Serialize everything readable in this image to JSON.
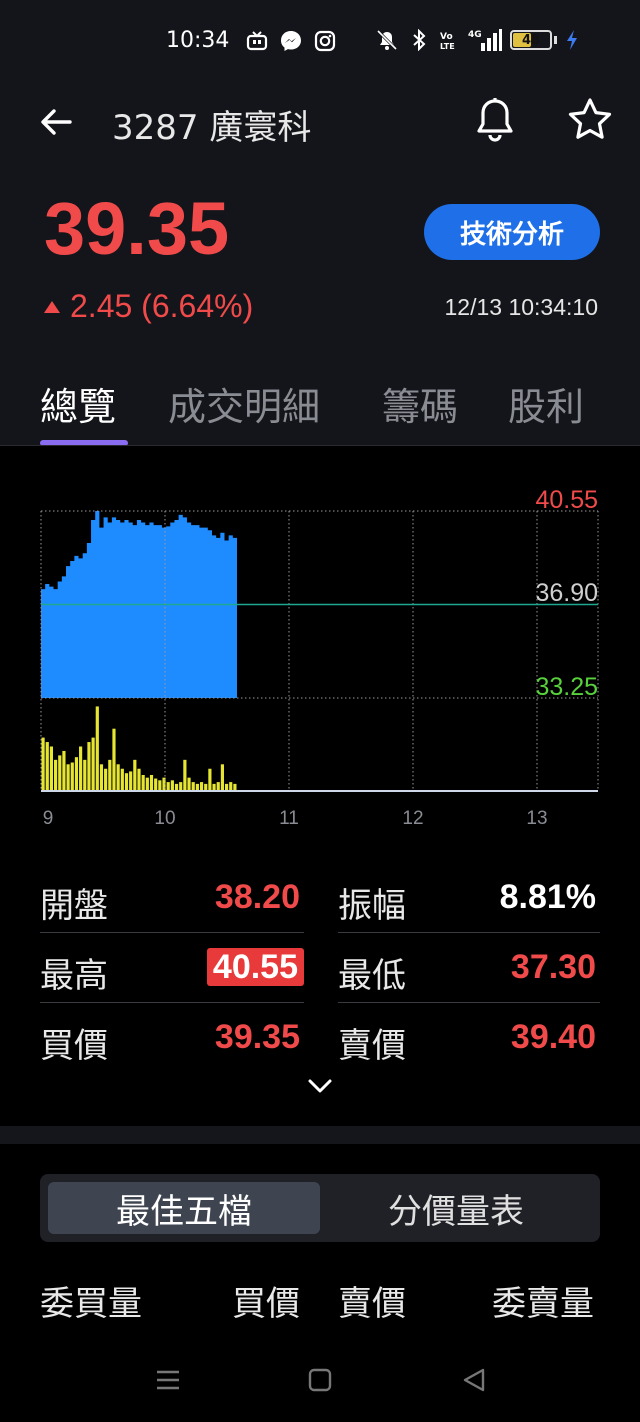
{
  "status_bar": {
    "time": "10:34",
    "battery_level": "48",
    "icons": [
      "tv-app-icon",
      "messenger-icon",
      "instagram-icon",
      "mute-icon",
      "bluetooth-icon",
      "volte-icon",
      "signal-4g-icon",
      "battery-icon",
      "charging-icon"
    ]
  },
  "header": {
    "stock_title": "3287 廣寰科",
    "icons": [
      "back-arrow-icon",
      "bell-icon",
      "star-icon"
    ]
  },
  "quote": {
    "price": "39.35",
    "change": "2.45 (6.64%)",
    "timestamp": "12/13 10:34:10",
    "technical_button": "技術分析"
  },
  "tabs": [
    "總覽",
    "成交明細",
    "籌碼",
    "股利"
  ],
  "chart_data": {
    "type": "area",
    "y_labels": [
      "40.55",
      "36.90",
      "33.25"
    ],
    "x_labels": [
      "9",
      "10",
      "11",
      "12",
      "13"
    ],
    "ylim": [
      33.25,
      40.55
    ],
    "reference_price": 36.9,
    "price_series": [
      37.5,
      37.7,
      37.6,
      37.5,
      37.8,
      38.0,
      38.4,
      38.6,
      38.8,
      38.7,
      38.9,
      39.3,
      40.2,
      40.55,
      39.9,
      40.3,
      40.1,
      40.3,
      40.2,
      40.1,
      40.2,
      40.1,
      40.0,
      40.2,
      40.1,
      40.0,
      40.1,
      40.0,
      40.0,
      39.9,
      39.95,
      40.1,
      40.2,
      40.4,
      40.3,
      40.1,
      40.0,
      40.0,
      39.9,
      39.9,
      39.8,
      39.6,
      39.5,
      39.7,
      39.4,
      39.6,
      39.5
    ],
    "volume_series": [
      0.6,
      0.55,
      0.5,
      0.35,
      0.4,
      0.45,
      0.3,
      0.32,
      0.38,
      0.5,
      0.35,
      0.55,
      0.6,
      0.95,
      0.3,
      0.25,
      0.35,
      0.7,
      0.3,
      0.25,
      0.2,
      0.22,
      0.35,
      0.25,
      0.18,
      0.15,
      0.18,
      0.14,
      0.12,
      0.15,
      0.1,
      0.12,
      0.08,
      0.1,
      0.35,
      0.15,
      0.1,
      0.08,
      0.1,
      0.08,
      0.25,
      0.08,
      0.1,
      0.3,
      0.08,
      0.1,
      0.08
    ],
    "colors": {
      "area": "#1e8cff",
      "volume": "#e6e632",
      "ref_line": "#1fa890",
      "top_label": "#f04a4a",
      "mid_label": "#cfcfcf",
      "bottom_label": "#58d13c"
    }
  },
  "stats": {
    "rows": [
      {
        "label_left": "開盤",
        "value_left": "38.20",
        "label_right": "振幅",
        "value_right": "8.81%"
      },
      {
        "label_left": "最高",
        "value_left": "40.55",
        "label_right": "最低",
        "value_right": "37.30"
      },
      {
        "label_left": "買價",
        "value_left": "39.35",
        "label_right": "賣價",
        "value_right": "39.40"
      }
    ]
  },
  "segmented": {
    "active": "最佳五檔",
    "inactive": "分價量表"
  },
  "order_book_headers": [
    "委買量",
    "買價",
    "賣價",
    "委賣量"
  ],
  "navbar": [
    "menu-icon",
    "home-square-icon",
    "back-triangle-icon"
  ]
}
